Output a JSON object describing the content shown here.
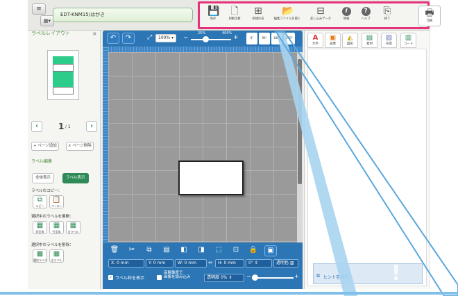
{
  "topbar": {
    "menu_icon": "≡",
    "doc_name": "EDT-KNM15/はがき"
  },
  "toolbar": {
    "buttons": [
      {
        "label": "保存",
        "icon": "save-icon"
      },
      {
        "label": "用紙切替",
        "icon": "paper-switch-icon"
      },
      {
        "label": "新規作成",
        "icon": "new-file-icon"
      },
      {
        "label": "編集ファイルを開く",
        "icon": "open-file-icon"
      },
      {
        "label": "差し込みデータ",
        "icon": "merge-data-icon"
      },
      {
        "label": "情報",
        "icon": "info-icon"
      },
      {
        "label": "ヘルプ",
        "icon": "help-icon"
      },
      {
        "label": "終了",
        "icon": "exit-icon"
      },
      {
        "label": "印刷",
        "icon": "print-icon"
      }
    ],
    "info_glyph": "i",
    "help_glyph": "?"
  },
  "left_panel": {
    "title": "ラベルレイアウト",
    "close": "×",
    "page_current": "1",
    "page_total": "/ 1",
    "add_page": "+ ページ追加",
    "delete_page": "× ページ削除",
    "edit_title": "ラベル編集",
    "show_all": "全体表示",
    "show_label": "ラベル表示",
    "copy_title": "ラベルのコピー：",
    "copy": "コピー",
    "paste": "ペースト",
    "expand_title": "選択中のラベルを展開：",
    "expand_all": "同全体",
    "expand_row": "行全体",
    "expand_all_labels": "全ラベル",
    "delete_title": "選択中のラベルを削除：",
    "delete_selected": "選択ラベル",
    "delete_all": "全ラベル"
  },
  "canvas": {
    "zoom": "100%",
    "zoom_min": "25%",
    "zoom_max": "400%",
    "rotate_labels": [
      "0°",
      "90°",
      "180°",
      "270°"
    ],
    "pos_x_label": "X:",
    "pos_x": "0 mm",
    "pos_y_label": "Y:",
    "pos_y": "0 mm",
    "width_label": "W:",
    "width": "0 mm",
    "height_label": "H:",
    "height": "0 mm",
    "angle": "0°",
    "transparent_color": "透明色",
    "show_frame": "ラベル枠を表示",
    "hires_line1": "高解像度で",
    "hires_line2": "画像を読み込み",
    "opacity_label": "透明度",
    "opacity": "0%"
  },
  "right_panel": {
    "tabs": [
      {
        "glyph": "A",
        "label": "文字",
        "color": "#d9342b"
      },
      {
        "glyph": "▣",
        "label": "画像",
        "color": "#e07b1f"
      },
      {
        "glyph": "◭",
        "label": "図形",
        "color": "#c9a400"
      },
      {
        "glyph": "▤",
        "label": "素材",
        "color": "#2e8b57"
      },
      {
        "glyph": "▨",
        "label": "背景",
        "color": "#6a7ab8"
      },
      {
        "glyph": "▥",
        "label": "コード",
        "color": "#2e8b57"
      }
    ],
    "hint": "ヒントを表示"
  },
  "colors": {
    "accent_blue": "#2c76b5",
    "highlight_pink": "#e6327a",
    "green": "#2e8b57"
  }
}
